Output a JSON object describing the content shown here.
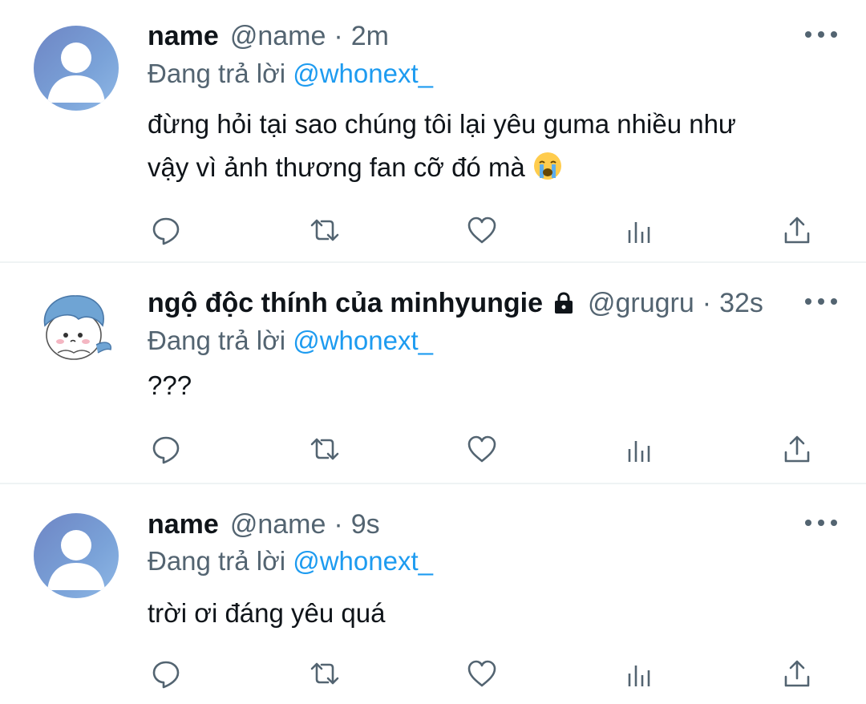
{
  "tweets": [
    {
      "display_name": "name",
      "handle": "@name",
      "separator": "·",
      "time": "2m",
      "avatar": "default-user-avatar",
      "locked": false,
      "reply_prefix": "Đang trả lời",
      "reply_to": "@whonext_",
      "text_line1": "đừng hỏi tại sao chúng tôi lại yêu guma nhiều như",
      "text_line2": "vậy vì ảnh thương fan cỡ đó mà",
      "emoji": "loudly-crying-face"
    },
    {
      "display_name": "ngộ độc thính của minhyungie",
      "handle": "@grugru",
      "separator": "·",
      "time": "32s",
      "avatar": "cartoon-character-avatar",
      "locked": true,
      "reply_prefix": "Đang trả lời",
      "reply_to": "@whonext_",
      "text_line1": "???"
    },
    {
      "display_name": "name",
      "handle": "@name",
      "separator": "·",
      "time": "9s",
      "avatar": "default-user-avatar",
      "locked": false,
      "reply_prefix": "Đang trả lời",
      "reply_to": "@whonext_",
      "text_line1": "trời ơi đáng yêu quá"
    }
  ],
  "actions": [
    "reply-icon",
    "retweet-icon",
    "like-icon",
    "analytics-icon",
    "share-icon"
  ],
  "colors": {
    "text": "#0f1419",
    "secondary": "#536471",
    "accent": "#1d9bf0",
    "divider": "#eff3f4"
  }
}
